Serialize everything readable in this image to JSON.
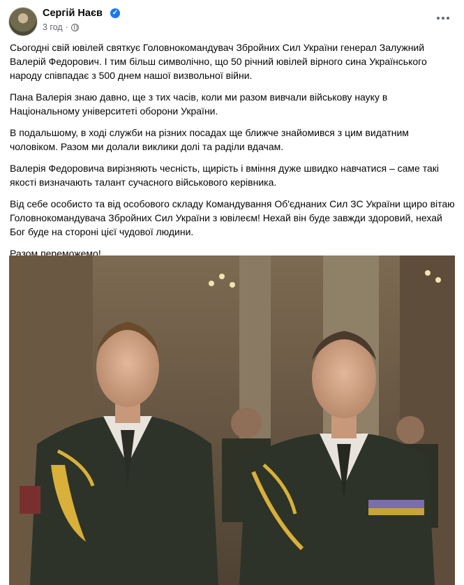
{
  "post": {
    "author": "Сергій Наєв",
    "time": "3 год",
    "paragraphs": [
      "Сьогодні свій ювілей святкує Головнокомандувач Збройних Сил України генерал Залужний Валерій Федорович. І тим більш символічно, що 50 річний ювілей вірного сина Українського народу співпадає з 500 днем нашої визвольної війни.",
      "Пана Валерія знаю давно, ще з тих часів, коли ми разом вивчали військову науку в Національному університеті оборони України.",
      "В подальшому, в ході служби на різних посадах ще ближче знайомився з цим видатним чоловіком. Разом ми долали виклики долі та раділи вдачам.",
      "Валерія Федоровича вирізняють чесність, щирість і вміння дуже швидко навчатися – саме такі якості визначають талант сучасного військового керівника.",
      "Від себе особисто та від особового складу Командування Об'єднаних Сил ЗС України  щиро вітаю Головнокомандувача Збройних Сил України з ювілеєм! Нехай він буде завжди здоровий, нехай Бог буде на стороні цієї чудової людини.",
      "Разом переможемо!"
    ]
  },
  "icons": {
    "verified": "verified-badge-icon",
    "audience": "globe-icon",
    "more": "more-options-icon"
  },
  "colors": {
    "accent": "#1877f2",
    "text": "#050505",
    "secondary": "#65676b"
  }
}
